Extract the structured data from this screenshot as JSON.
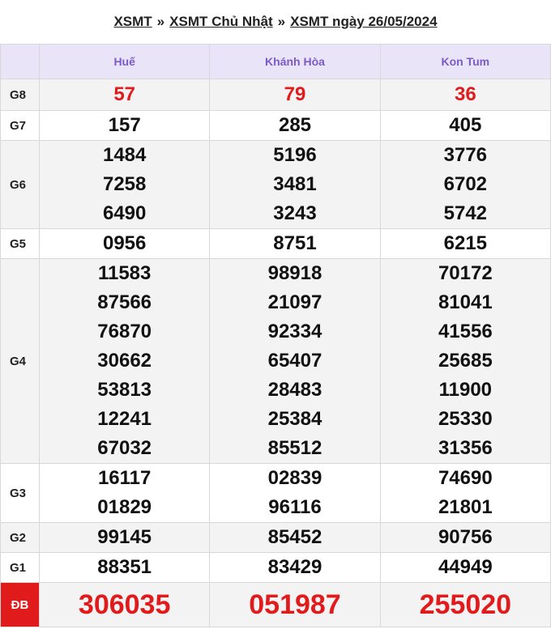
{
  "title": {
    "part1": "XSMT",
    "sep1": "»",
    "part2": "XSMT Chủ Nhật",
    "sep2": "»",
    "part3": "XSMT ngày 26/05/2024"
  },
  "provinces": [
    "Huế",
    "Khánh Hòa",
    "Kon Tum"
  ],
  "rows": [
    {
      "label": "G8",
      "values": [
        [
          "57"
        ],
        [
          "79"
        ],
        [
          "36"
        ]
      ]
    },
    {
      "label": "G7",
      "values": [
        [
          "157"
        ],
        [
          "285"
        ],
        [
          "405"
        ]
      ]
    },
    {
      "label": "G6",
      "values": [
        [
          "1484",
          "7258",
          "6490"
        ],
        [
          "5196",
          "3481",
          "3243"
        ],
        [
          "3776",
          "6702",
          "5742"
        ]
      ]
    },
    {
      "label": "G5",
      "values": [
        [
          "0956"
        ],
        [
          "8751"
        ],
        [
          "6215"
        ]
      ]
    },
    {
      "label": "G4",
      "values": [
        [
          "11583",
          "87566",
          "76870",
          "30662",
          "53813",
          "12241",
          "67032"
        ],
        [
          "98918",
          "21097",
          "92334",
          "65407",
          "28483",
          "25384",
          "85512"
        ],
        [
          "70172",
          "81041",
          "41556",
          "25685",
          "11900",
          "25330",
          "31356"
        ]
      ]
    },
    {
      "label": "G3",
      "values": [
        [
          "16117",
          "01829"
        ],
        [
          "02839",
          "96116"
        ],
        [
          "74690",
          "21801"
        ]
      ]
    },
    {
      "label": "G2",
      "values": [
        [
          "99145"
        ],
        [
          "85452"
        ],
        [
          "90756"
        ]
      ]
    },
    {
      "label": "G1",
      "values": [
        [
          "88351"
        ],
        [
          "83429"
        ],
        [
          "44949"
        ]
      ]
    },
    {
      "label": "ĐB",
      "values": [
        [
          "306035"
        ],
        [
          "051987"
        ],
        [
          "255020"
        ]
      ]
    }
  ],
  "colors": {
    "header_text": "#7b5ac9",
    "header_bg": "#e9e4f7",
    "accent_red": "#e11b1b"
  }
}
